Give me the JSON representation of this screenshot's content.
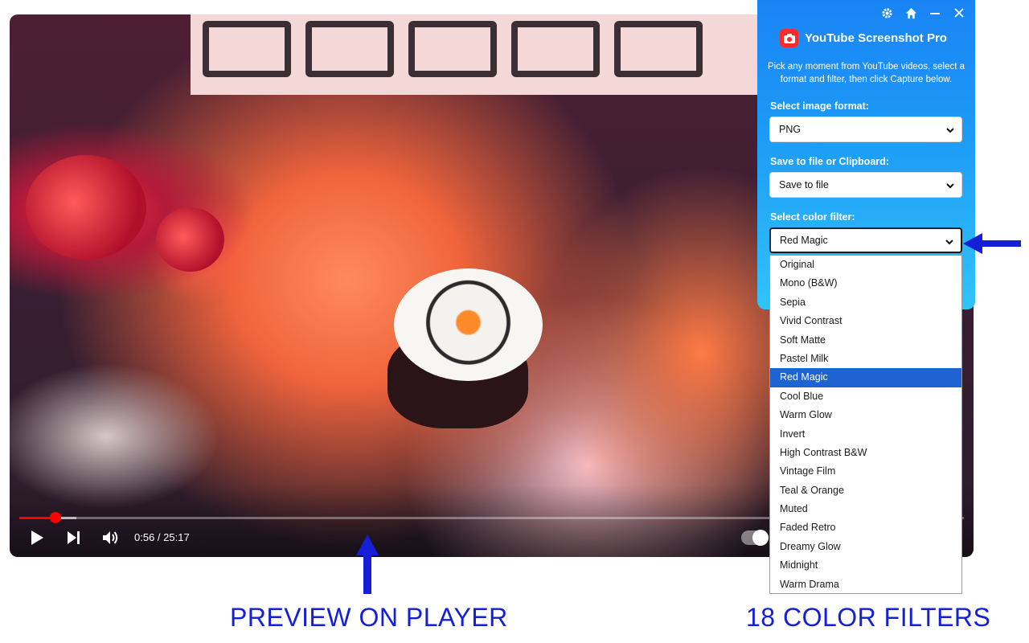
{
  "player": {
    "time_display": "0:56 / 25:17",
    "progress_fraction": 0.037,
    "colors": {
      "progress": "#ff0000"
    }
  },
  "popup": {
    "title": "YouTube Screenshot Pro",
    "intro": "Pick any moment from YouTube videos, select a format and filter, then click Capture below.",
    "format_label": "Select image format:",
    "format_value": "PNG",
    "save_label": "Save to file or Clipboard:",
    "save_value": "Save to file",
    "filter_label": "Select color filter:",
    "filter_value": "Red Magic",
    "icons": [
      "settings-icon",
      "home-icon",
      "minimize-icon",
      "close-icon"
    ],
    "colors": {
      "gradient_top": "#1a84f5",
      "gradient_bottom": "#31c3fa",
      "logo": "#ff2a2a"
    }
  },
  "filter_options": [
    "Original",
    "Mono (B&W)",
    "Sepia",
    "Vivid Contrast",
    "Soft Matte",
    "Pastel Milk",
    "Red Magic",
    "Cool Blue",
    "Warm Glow",
    "Invert",
    "High Contrast B&W",
    "Vintage Film",
    "Teal & Orange",
    "Muted",
    "Faded Retro",
    "Dreamy Glow",
    "Midnight",
    "Warm Drama"
  ],
  "selected_filter_index": 6,
  "annotations": {
    "left_caption": "PREVIEW ON PLAYER",
    "right_caption": "18 COLOR FILTERS",
    "color": "#1520d6"
  }
}
